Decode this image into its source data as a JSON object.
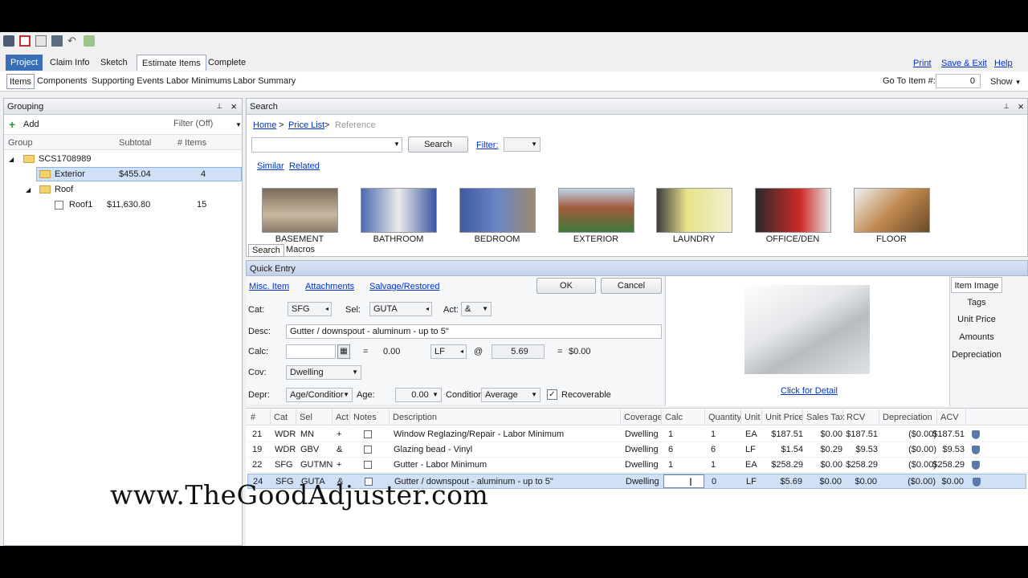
{
  "nav": {
    "tabs": [
      "Project",
      "Claim Info",
      "Sketch",
      "Estimate Items",
      "Complete"
    ],
    "right_links": [
      "Print",
      "Save & Exit",
      "Help"
    ],
    "subtabs": [
      "Items",
      "Components",
      "Supporting Events",
      "Labor Minimums",
      "Labor Summary"
    ],
    "goto_label": "Go To Item #:",
    "goto_value": "0",
    "show_label": "Show"
  },
  "grouping": {
    "title": "Grouping",
    "add_label": "Add",
    "filter_label": "Filter (Off)",
    "columns": [
      "Group",
      "Subtotal",
      "# Items"
    ],
    "tree": [
      {
        "name": "SCS1708989",
        "subtotal": "",
        "items": "",
        "level": 0
      },
      {
        "name": "Exterior",
        "subtotal": "$455.04",
        "items": "4",
        "level": 1
      },
      {
        "name": "Roof",
        "subtotal": "",
        "items": "",
        "level": 1
      },
      {
        "name": "Roof1",
        "subtotal": "$11,630.80",
        "items": "15",
        "level": 2
      }
    ]
  },
  "search": {
    "title": "Search",
    "breadcrumb": [
      "Home",
      "Price List",
      "Reference"
    ],
    "breadcrumb_sep": ">",
    "search_button": "Search",
    "filter_label": "Filter:",
    "similar": "Similar",
    "related": "Related",
    "thumbnails": [
      "BASEMENT",
      "BATHROOM",
      "BEDROOM",
      "EXTERIOR",
      "LAUNDRY",
      "OFFICE/DEN",
      "FLOOR"
    ],
    "bottom_tabs": [
      "Search",
      "Macros"
    ]
  },
  "quick_entry": {
    "title": "Quick Entry",
    "links": [
      "Misc. Item",
      "Attachments",
      "Salvage/Restored"
    ],
    "ok": "OK",
    "cancel": "Cancel",
    "cat_label": "Cat:",
    "cat_value": "SFG",
    "sel_label": "Sel:",
    "sel_value": "GUTA",
    "act_label": "Act:",
    "act_value": "&",
    "desc_label": "Desc:",
    "desc_value": "Gutter / downspout - aluminum - up to 5\"",
    "calc_label": "Calc:",
    "calc_eq": "=",
    "calc_result": "0.00",
    "unit": "LF",
    "at": "@",
    "price": "5.69",
    "total_eq": "=",
    "total": "$0.00",
    "cov_label": "Cov:",
    "cov_value": "Dwelling",
    "depr_label": "Depr:",
    "depr_value": "Age/Conditior",
    "age_label": "Age:",
    "age_value": "0.00",
    "condition_label": "Condition",
    "condition_value": "Average",
    "recoverable_label": "Recoverable",
    "click_detail": "Click for Detail",
    "side_tabs": [
      "Item Image",
      "Tags",
      "Unit Price",
      "Amounts",
      "Depreciation"
    ]
  },
  "items_table": {
    "columns": [
      "#",
      "Cat",
      "Sel",
      "Act",
      "Notes",
      "Description",
      "Coverage",
      "Calc",
      "Quantity",
      "Unit",
      "Unit Price",
      "Sales Tax",
      "RCV",
      "Depreciation",
      "ACV"
    ],
    "rows": [
      [
        "21",
        "WDR",
        "MN",
        "+",
        "",
        "Window Reglazing/Repair - Labor Minimum",
        "Dwelling",
        "1",
        "1",
        "EA",
        "$187.51",
        "$0.00",
        "$187.51",
        "($0.00)",
        "$187.51"
      ],
      [
        "19",
        "WDR",
        "GBV",
        "&",
        "",
        "Glazing bead - Vinyl",
        "Dwelling",
        "6",
        "6",
        "LF",
        "$1.54",
        "$0.29",
        "$9.53",
        "($0.00)",
        "$9.53"
      ],
      [
        "22",
        "SFG",
        "GUTMN",
        "+",
        "",
        "Gutter - Labor Minimum",
        "Dwelling",
        "1",
        "1",
        "EA",
        "$258.29",
        "$0.00",
        "$258.29",
        "($0.00)",
        "$258.29"
      ],
      [
        "24",
        "SFG",
        "GUTA",
        "&",
        "",
        "Gutter / downspout - aluminum - up to 5\"",
        "Dwelling",
        "",
        "0",
        "LF",
        "$5.69",
        "$0.00",
        "$0.00",
        "($0.00)",
        "$0.00"
      ]
    ]
  },
  "watermark": "www.TheGoodAdjuster.com",
  "colors": {
    "accent": "#3a6fb8",
    "selection": "#cfe0f7",
    "link": "#0033cc"
  }
}
